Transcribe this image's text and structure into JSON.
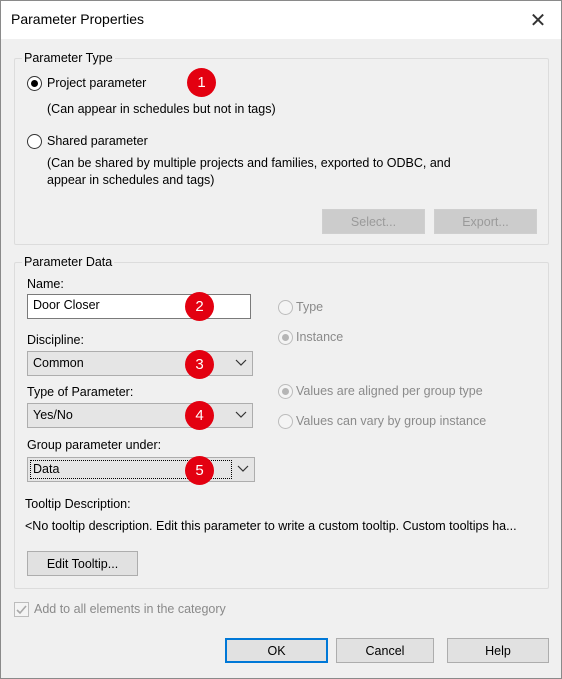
{
  "window": {
    "title": "Parameter Properties",
    "close_glyph": "✕"
  },
  "parameter_type": {
    "group_title": "Parameter Type",
    "project": {
      "label": "Project parameter",
      "description": "(Can appear in schedules but not in tags)",
      "selected": true
    },
    "shared": {
      "label": "Shared parameter",
      "description_line1": "(Can be shared by multiple projects and families, exported to ODBC, and",
      "description_line2": "appear in schedules and tags)",
      "selected": false
    },
    "select_button": "Select...",
    "export_button": "Export..."
  },
  "parameter_data": {
    "group_title": "Parameter Data",
    "name_label": "Name:",
    "name_value": "Door Closer",
    "discipline_label": "Discipline:",
    "discipline_value": "Common",
    "type_label": "Type of Parameter:",
    "type_value": "Yes/No",
    "group_label": "Group parameter under:",
    "group_value": "Data",
    "type_radio": "Type",
    "instance_radio": "Instance",
    "aligned_radio": "Values are aligned per group type",
    "vary_radio": "Values can vary by group instance",
    "tooltip_label": "Tooltip Description:",
    "tooltip_text": "<No tooltip description. Edit this parameter to write a custom tooltip. Custom tooltips ha...",
    "edit_tooltip_button": "Edit Tooltip..."
  },
  "add_to_all": {
    "label": "Add to all elements in the category",
    "checked": true
  },
  "buttons": {
    "ok": "OK",
    "cancel": "Cancel",
    "help": "Help"
  },
  "badges": [
    "1",
    "2",
    "3",
    "4",
    "5"
  ],
  "colors": {
    "badge": "#e30010",
    "default_button_border": "#0078d7",
    "dialog_background": "#f0f0f0"
  }
}
